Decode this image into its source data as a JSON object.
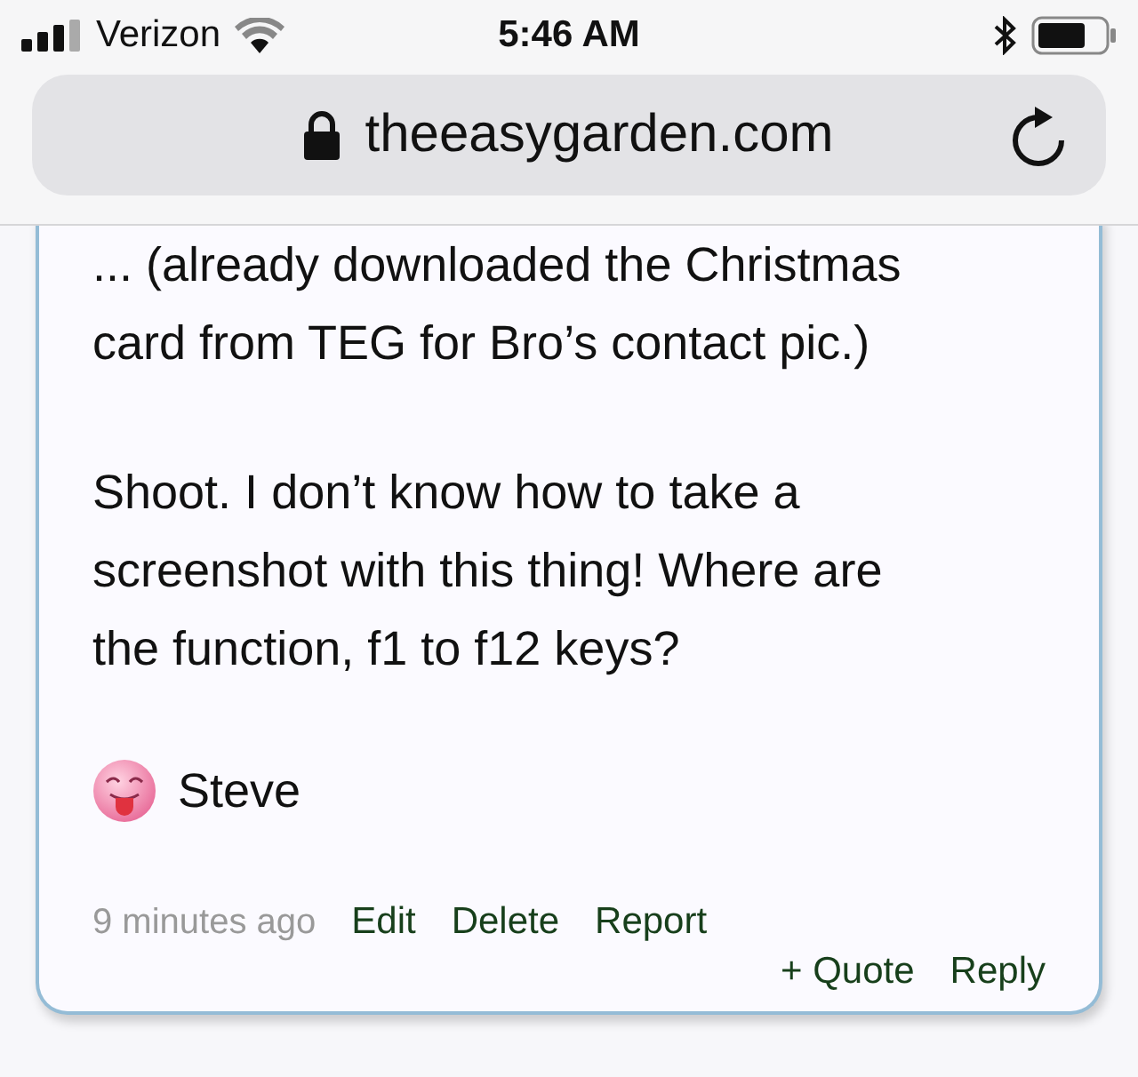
{
  "status_bar": {
    "carrier": "Verizon",
    "time": "5:46 AM"
  },
  "address_bar": {
    "url": "theeasygarden.com"
  },
  "post": {
    "paragraphs": [
      [
        "... (already downloaded the Christmas",
        "card from TEG for Bro’s contact pic.)"
      ],
      [
        "Shoot. I don’t know how to take a",
        "screenshot with this thing! Where are",
        "the function, f1 to f12 keys?"
      ]
    ],
    "signature": "Steve",
    "timestamp": "9 minutes ago",
    "actions": [
      "Edit",
      "Delete",
      "Report"
    ],
    "reply_actions": [
      "+ Quote",
      "Reply"
    ]
  }
}
